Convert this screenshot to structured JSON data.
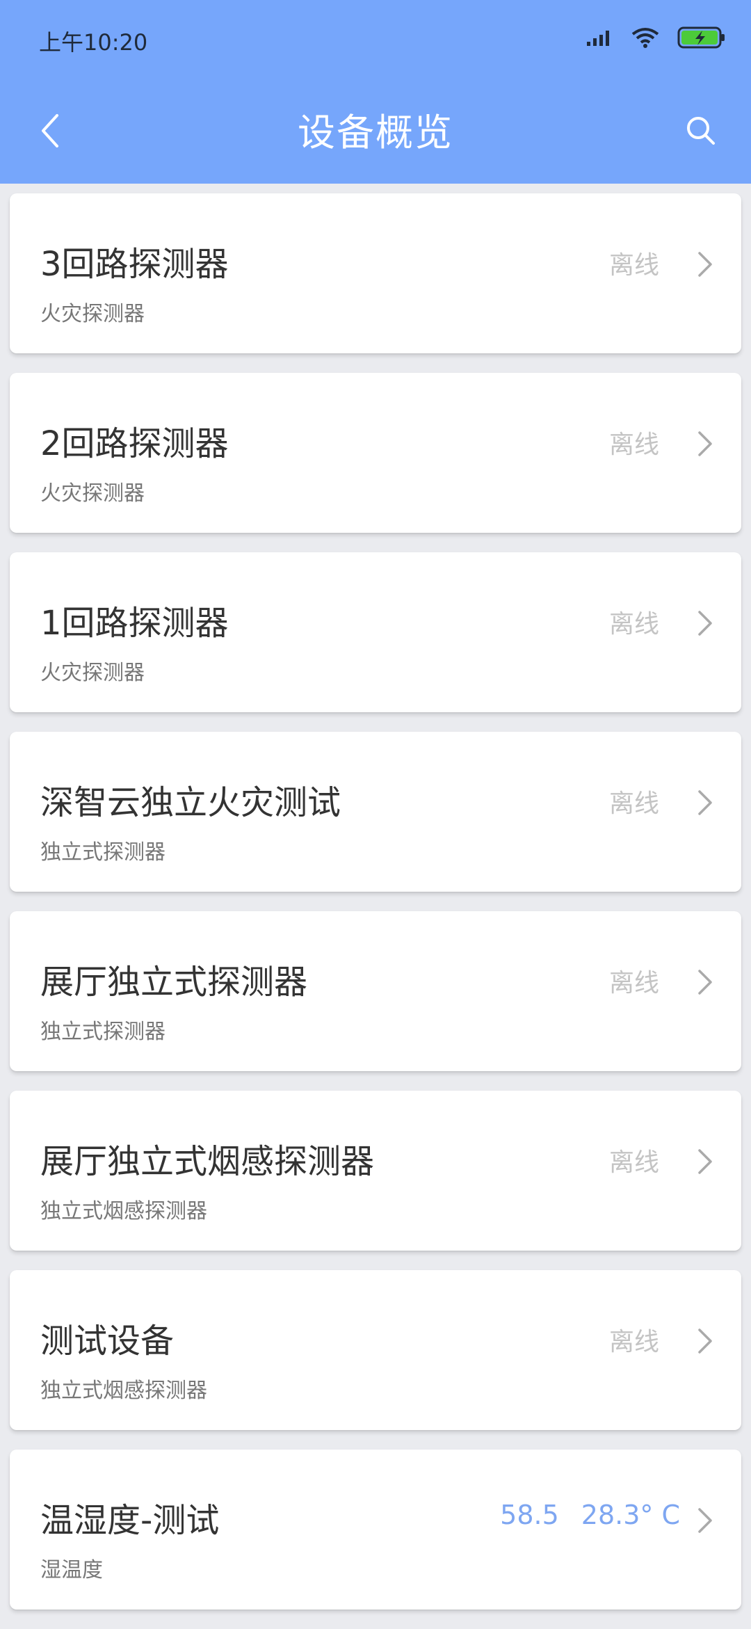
{
  "status_bar": {
    "time": "上午10:20"
  },
  "header": {
    "title": "设备概览"
  },
  "devices": [
    {
      "name": "3回路探测器",
      "type": "火灾探测器",
      "status": "离线"
    },
    {
      "name": "2回路探测器",
      "type": "火灾探测器",
      "status": "离线"
    },
    {
      "name": "1回路探测器",
      "type": "火灾探测器",
      "status": "离线"
    },
    {
      "name": "深智云独立火灾测试",
      "type": "独立式探测器",
      "status": "离线"
    },
    {
      "name": "展厅独立式探测器",
      "type": "独立式探测器",
      "status": "离线"
    },
    {
      "name": "展厅独立式烟感探测器",
      "type": "独立式烟感探测器",
      "status": "离线"
    },
    {
      "name": "测试设备",
      "type": "独立式烟感探测器",
      "status": "离线"
    },
    {
      "name": "温湿度-测试",
      "type": "湿温度",
      "humidity": "58.5",
      "temperature": "28.3° C"
    }
  ],
  "colors": {
    "header_bg": "#76a6fb",
    "reading_blue": "#7ea6f1",
    "status_gray": "#c4c4c4"
  }
}
